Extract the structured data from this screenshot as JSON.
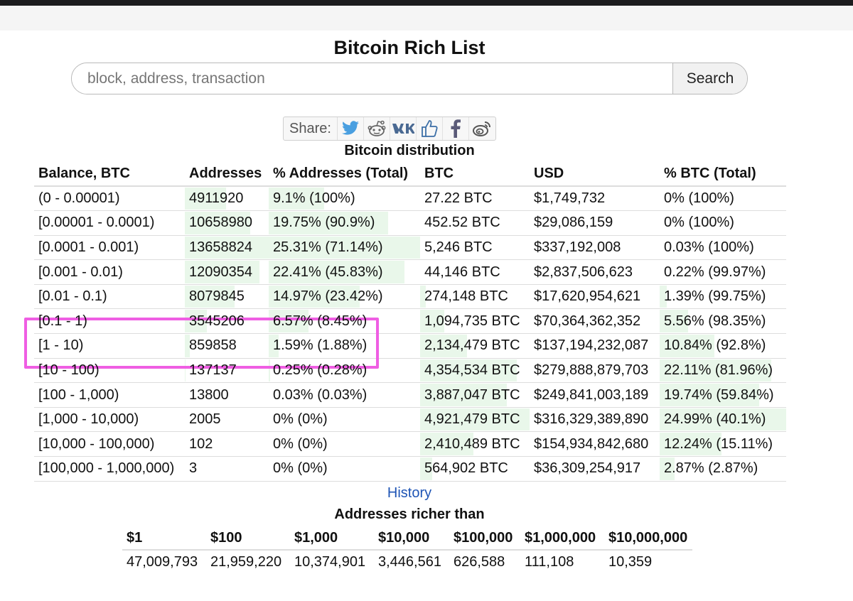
{
  "page": {
    "title": "Bitcoin Rich List"
  },
  "search": {
    "placeholder": "block, address, transaction",
    "button_label": "Search"
  },
  "share": {
    "label": "Share:",
    "icons": [
      "twitter-icon",
      "reddit-icon",
      "vk-icon",
      "thumbs-up-icon",
      "facebook-icon",
      "weibo-icon"
    ]
  },
  "distribution": {
    "title": "Bitcoin distribution",
    "headers": [
      "Balance, BTC",
      "Addresses",
      "% Addresses (Total)",
      "BTC",
      "USD",
      "% BTC (Total)"
    ],
    "rows": [
      {
        "balance": "(0 - 0.00001)",
        "addresses": "4911920",
        "pct_addresses": "9.1% (100%)",
        "btc": "27.22 BTC",
        "usd": "$1,749,732",
        "pct_btc": "0% (100%)",
        "addr_fill": 0.49,
        "pct_fill": 0.091,
        "btc_fill": 0.0,
        "pctbtc_fill": 0.0
      },
      {
        "balance": "[0.00001 - 0.0001)",
        "addresses": "10658980",
        "pct_addresses": "19.75% (90.9%)",
        "btc": "452.52 BTC",
        "usd": "$29,086,159",
        "pct_btc": "0% (100%)",
        "addr_fill": 0.78,
        "pct_fill": 0.1975,
        "btc_fill": 0.0,
        "pctbtc_fill": 0.0
      },
      {
        "balance": "[0.0001 - 0.001)",
        "addresses": "13658824",
        "pct_addresses": "25.31% (71.14%)",
        "btc": "5,246 BTC",
        "usd": "$337,192,008",
        "pct_btc": "0.03% (100%)",
        "addr_fill": 1.0,
        "pct_fill": 0.2531,
        "btc_fill": 0.0,
        "pctbtc_fill": 0.0
      },
      {
        "balance": "[0.001 - 0.01)",
        "addresses": "12090354",
        "pct_addresses": "22.41% (45.83%)",
        "btc": "44,146 BTC",
        "usd": "$2,837,506,623",
        "pct_btc": "0.22% (99.97%)",
        "addr_fill": 0.89,
        "pct_fill": 0.2241,
        "btc_fill": 0.0,
        "pctbtc_fill": 0.0
      },
      {
        "balance": "[0.01 - 0.1)",
        "addresses": "8079845",
        "pct_addresses": "14.97% (23.42%)",
        "btc": "274,148 BTC",
        "usd": "$17,620,954,621",
        "pct_btc": "1.39% (99.75%)",
        "addr_fill": 0.59,
        "pct_fill": 0.1497,
        "btc_fill": 0.05,
        "pctbtc_fill": 0.014
      },
      {
        "balance": "[0.1 - 1)",
        "addresses": "3545206",
        "pct_addresses": "6.57% (8.45%)",
        "btc": "1,094,735 BTC",
        "usd": "$70,364,362,352",
        "pct_btc": "5.56% (98.35%)",
        "addr_fill": 0.26,
        "pct_fill": 0.0657,
        "btc_fill": 0.22,
        "pctbtc_fill": 0.056
      },
      {
        "balance": "[1 - 10)",
        "addresses": "859858",
        "pct_addresses": "1.59% (1.88%)",
        "btc": "2,134,479 BTC",
        "usd": "$137,194,232,087",
        "pct_btc": "10.84% (92.8%)",
        "addr_fill": 0.06,
        "pct_fill": 0.0159,
        "btc_fill": 0.43,
        "pctbtc_fill": 0.108
      },
      {
        "balance": "[10 - 100)",
        "addresses": "137137",
        "pct_addresses": "0.25% (0.28%)",
        "btc": "4,354,534 BTC",
        "usd": "$279,888,879,703",
        "pct_btc": "22.11% (81.96%)",
        "addr_fill": 0.01,
        "pct_fill": 0.0025,
        "btc_fill": 0.88,
        "pctbtc_fill": 0.221
      },
      {
        "balance": "[100 - 1,000)",
        "addresses": "13800",
        "pct_addresses": "0.03% (0.03%)",
        "btc": "3,887,047 BTC",
        "usd": "$249,841,003,189",
        "pct_btc": "19.74% (59.84%)",
        "addr_fill": 0.0,
        "pct_fill": 0.0,
        "btc_fill": 0.79,
        "pctbtc_fill": 0.197
      },
      {
        "balance": "[1,000 - 10,000)",
        "addresses": "2005",
        "pct_addresses": "0% (0%)",
        "btc": "4,921,479 BTC",
        "usd": "$316,329,389,890",
        "pct_btc": "24.99% (40.1%)",
        "addr_fill": 0.0,
        "pct_fill": 0.0,
        "btc_fill": 1.0,
        "pctbtc_fill": 0.25
      },
      {
        "balance": "[10,000 - 100,000)",
        "addresses": "102",
        "pct_addresses": "0% (0%)",
        "btc": "2,410,489 BTC",
        "usd": "$154,934,842,680",
        "pct_btc": "12.24% (15.11%)",
        "addr_fill": 0.0,
        "pct_fill": 0.0,
        "btc_fill": 0.49,
        "pctbtc_fill": 0.122
      },
      {
        "balance": "[100,000 - 1,000,000)",
        "addresses": "3",
        "pct_addresses": "0% (0%)",
        "btc": "564,902 BTC",
        "usd": "$36,309,254,917",
        "pct_btc": "2.87% (2.87%)",
        "addr_fill": 0.0,
        "pct_fill": 0.0,
        "btc_fill": 0.11,
        "pctbtc_fill": 0.029
      }
    ]
  },
  "history_link": "History",
  "richer": {
    "title": "Addresses richer than",
    "headers": [
      "$1",
      "$100",
      "$1,000",
      "$10,000",
      "$100,000",
      "$1,000,000",
      "$10,000,000"
    ],
    "values": [
      "47,009,793",
      "21,959,220",
      "10,374,901",
      "3,446,561",
      "626,588",
      "111,108",
      "10,359"
    ]
  },
  "colors": {
    "highlight": "#ef5ee3",
    "bar_fill": "#e9f7ea",
    "link": "#1f55b5"
  }
}
